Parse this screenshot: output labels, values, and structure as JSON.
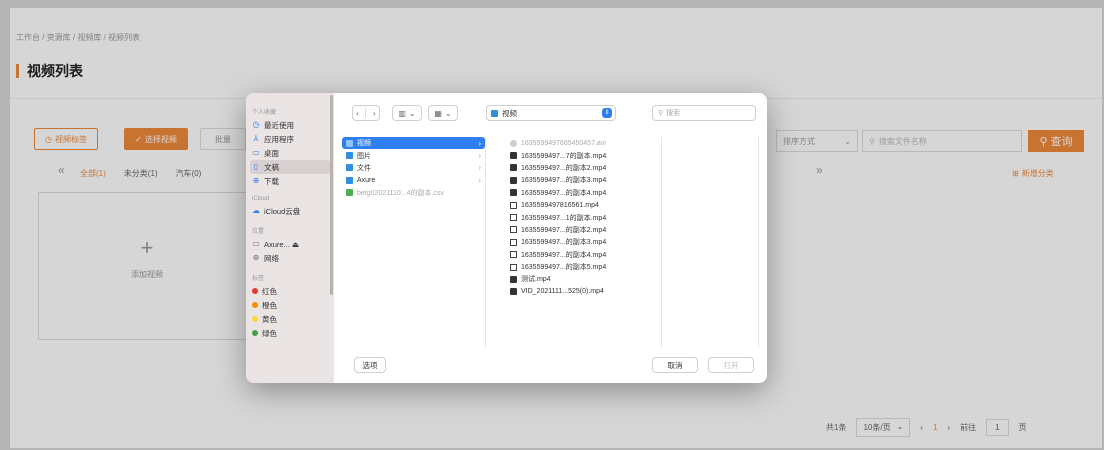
{
  "app": {
    "breadcrumb": "工作台 / 资源库 / 视频库 / 视频列表",
    "page_title": "视频列表",
    "toolbar": {
      "btn1": "视频标签",
      "btn2": "选择视频",
      "btn3": "批量",
      "sort_placeholder": "排序方式",
      "search_placeholder": "搜索文件名称",
      "search_button": "查询"
    },
    "categories": [
      "全部(1)",
      "未分类(1)",
      "汽车(0)"
    ],
    "add_category": "新增分类",
    "add_video_label": "添加视频",
    "pagination": {
      "total": "共1条",
      "per_page": "10条/页",
      "current_page": "1",
      "goto_label": "前往",
      "goto_value": "1",
      "page_suffix": "页"
    }
  },
  "dialog": {
    "sidebar": {
      "personal_header": "个人收藏",
      "personal": [
        {
          "label": "最近使用",
          "icon": "clock-icon"
        },
        {
          "label": "应用程序",
          "icon": "apps-icon"
        },
        {
          "label": "桌面",
          "icon": "desktop-icon"
        },
        {
          "label": "文稿",
          "icon": "document-icon"
        },
        {
          "label": "下载",
          "icon": "download-icon"
        }
      ],
      "icloud_header": "iCloud",
      "icloud": [
        {
          "label": "iCloud云盘",
          "icon": "cloud-icon"
        }
      ],
      "locations_header": "位置",
      "locations": [
        {
          "label": "Axure... ⏏",
          "icon": "disk-icon"
        },
        {
          "label": "网络",
          "icon": "globe-icon"
        }
      ],
      "tags_header": "标签",
      "tags": [
        {
          "label": "红色",
          "color": "#e53935"
        },
        {
          "label": "橙色",
          "color": "#fb8c00"
        },
        {
          "label": "黄色",
          "color": "#fdd835"
        },
        {
          "label": "绿色",
          "color": "#43a047"
        }
      ]
    },
    "location": "视频",
    "search_placeholder": "搜索",
    "column1": [
      {
        "label": "视频",
        "type": "folder",
        "selected": true,
        "has_children": true
      },
      {
        "label": "图片",
        "type": "folder",
        "has_children": true
      },
      {
        "label": "文件",
        "type": "folder",
        "has_children": true
      },
      {
        "label": "Axure",
        "type": "folder",
        "has_children": true
      },
      {
        "label": "betg02021110...4的副本.csv",
        "type": "sheet",
        "dim": true
      }
    ],
    "column2": [
      {
        "label": "1635599497685450457.avi",
        "type": "gray",
        "dim": true
      },
      {
        "label": "1635599497...7的副本.mp4",
        "type": "video"
      },
      {
        "label": "1635599497...的副本2.mp4",
        "type": "video"
      },
      {
        "label": "1635599497...的副本3.mp4",
        "type": "video"
      },
      {
        "label": "1635599497...的副本4.mp4",
        "type": "video"
      },
      {
        "label": "163559949781656​1.mp4",
        "type": "vidout"
      },
      {
        "label": "1635599497...1的副本.mp4",
        "type": "vidout"
      },
      {
        "label": "1635599497...的副本2.mp4",
        "type": "vidout"
      },
      {
        "label": "1635599497...的副本3.mp4",
        "type": "vidout"
      },
      {
        "label": "1635599497...的副本4.mp4",
        "type": "vidout"
      },
      {
        "label": "1635599497...的副本5.mp4",
        "type": "vidout"
      },
      {
        "label": "测试.mp4",
        "type": "video"
      },
      {
        "label": "VID_2021111...525(0).mp4",
        "type": "video"
      }
    ],
    "buttons": {
      "options": "选项",
      "cancel": "取消",
      "open": "打开"
    }
  }
}
